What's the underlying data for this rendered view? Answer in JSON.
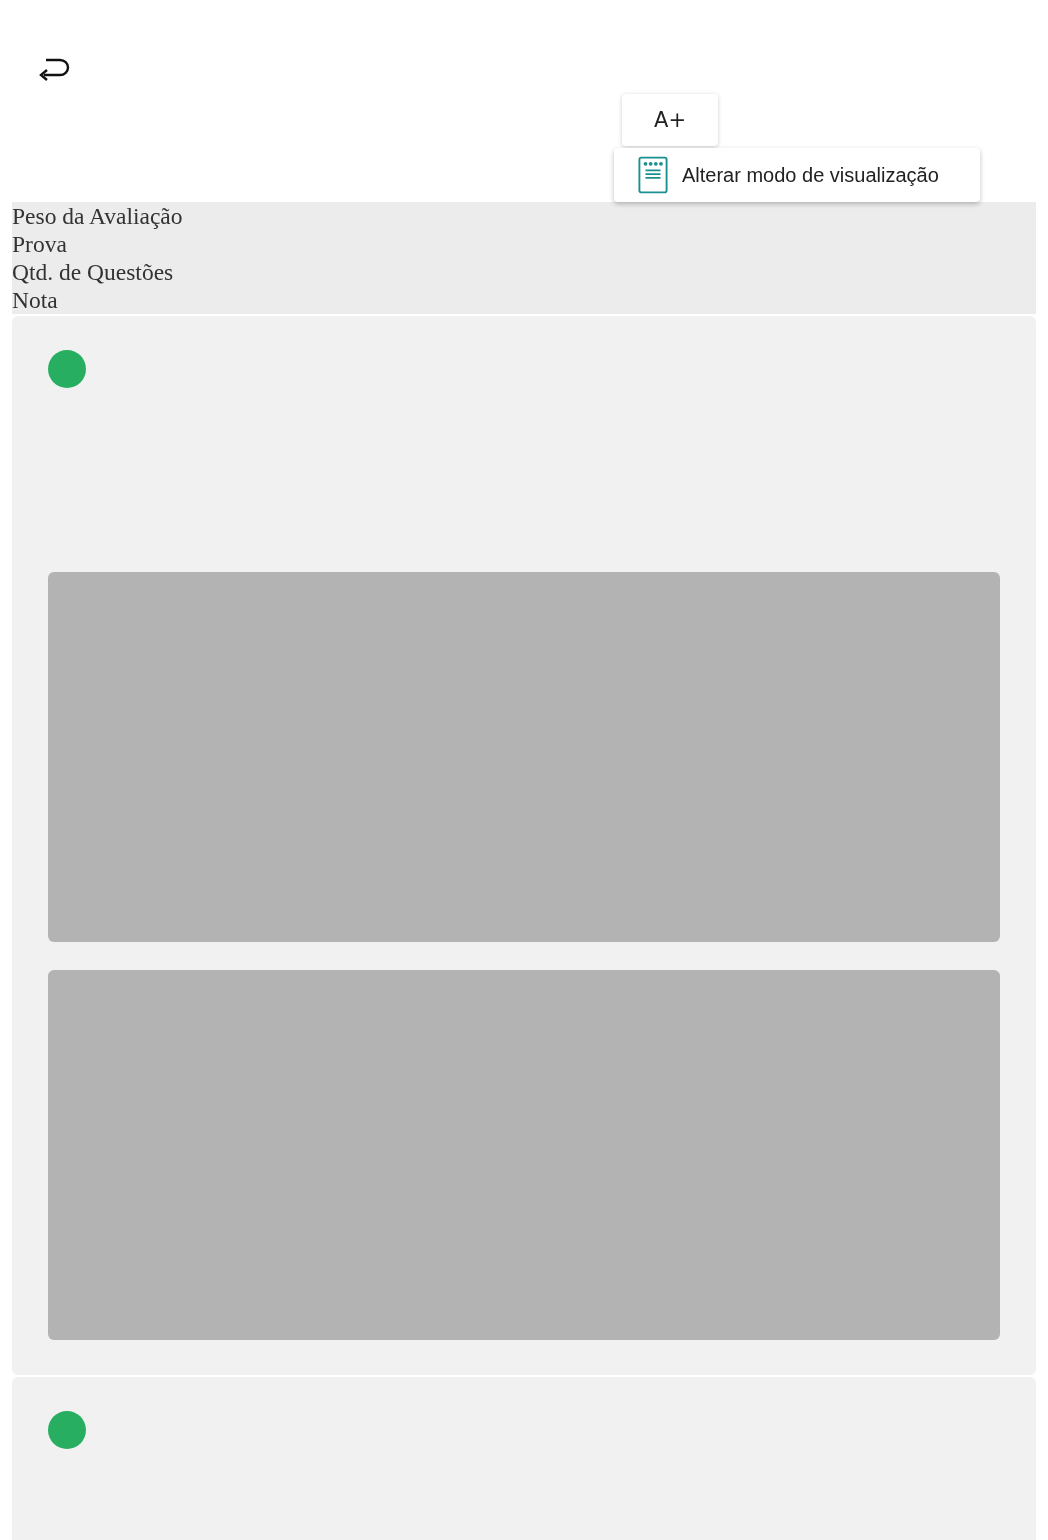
{
  "toolbar": {
    "font_button": "A+",
    "menu_item": "Alterar modo de visualização"
  },
  "header_labels": [
    "Peso da Avaliação",
    "Prova",
    "Qtd. de Questões",
    "Nota"
  ],
  "cards": [
    {
      "color": "#27ae60",
      "blocks": [
        {
          "kind": "placeholder"
        },
        {
          "kind": "placeholder"
        }
      ]
    },
    {
      "color": "#27ae60"
    }
  ]
}
